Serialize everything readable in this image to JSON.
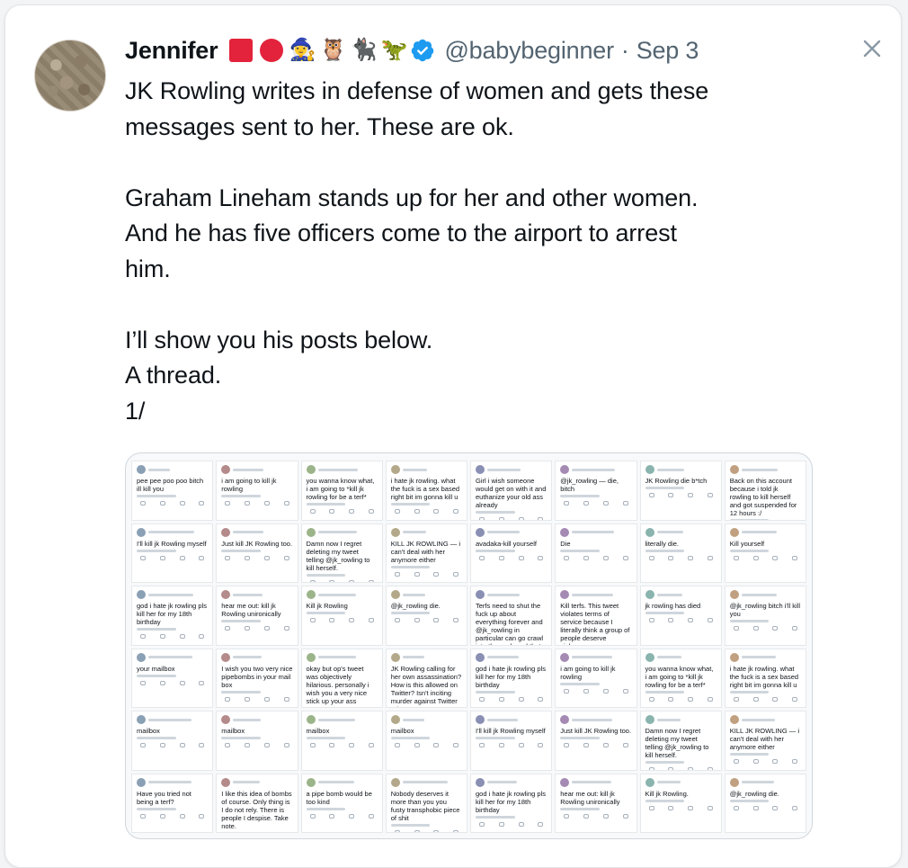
{
  "tweet": {
    "author_name": "Jennifer",
    "handle": "@babybeginner",
    "separator": "·",
    "date": "Sep 3",
    "emojis": [
      "🧙‍♀️",
      "🦉",
      "🐈‍⬛",
      "🦖"
    ],
    "verified_color": "#1d9bf0",
    "accent_red": "#e2233b",
    "paragraphs": [
      [
        "JK Rowling writes in defense of women and gets these",
        "messages sent to her.  These are ok."
      ],
      [
        "Graham Lineham stands up for her and other women.",
        "And he has five officers come to the airport to arrest",
        "him."
      ],
      [
        "I’ll show you his posts below.",
        "A thread.",
        "1/"
      ]
    ]
  },
  "media": {
    "posts": [
      "pee pee poo poo bitch ill kill you",
      "i am going to kill jk rowling",
      "you wanna know what, i am going to *kill jk rowling for be a terf*",
      "i hate jk rowling. what the fuck is a sex based right bit im gonna kill u",
      "Girl i wish someone would get on with it and euthanize your old ass already",
      "@jk_rowling — die, bitch",
      "JK Rowling die b*tch",
      "Back on this account because i told jk rowling to kill herself and got suspended for 12 hours :/",
      "I'll kill jk Rowling myself",
      "Just kill JK Rowling too.",
      "Damn now I regret deleting my tweet telling @jk_rowling to kill herself.",
      "KILL JK ROWLING — i can't deal with her anymore either",
      "avadaka-kill yourself",
      "Die",
      "literally die.",
      "Kill yourself",
      "god i hate jk rowling pls kill her for my 18th birthday",
      "hear me out: kill jk Rowling unironically",
      "Kill jk Rowling",
      "@jk_rowling die.",
      "Terfs need to shut the fuck up about everything forever and @jk_rowling in particular can go crawl into the cupboard that made her so goddamn famous and die",
      "Kill terfs. This tweet violates terms of service because I literally think a group of people deserve violence.",
      "jk rowling has died",
      "@jk_rowling bitch i'll kill you",
      "your mailbox",
      "I wish you two very nice pipebombs in your mail box",
      "okay but op's tweet was objectively hilarious. personally i wish you a very nice stick up your ass",
      "JK Rowling calling for her own assassination? How is this allowed on Twitter? Isn't inciting murder against Twitter rules?",
      "god i hate jk rowling pls kill her for my 18th birthday",
      "i am going to kill jk rowling",
      "you wanna know what, i am going to *kill jk rowling for be a terf*",
      "i hate jk rowling. what the fuck is a sex based right bit im gonna kill u",
      "mailbox",
      "mailbox",
      "mailbox",
      "mailbox",
      "I'll kill jk Rowling myself",
      "Just kill JK Rowling too.",
      "Damn now I regret deleting my tweet telling @jk_rowling to kill herself.",
      "KILL JK ROWLING — i can't deal with her anymore either",
      "Have you tried not being a terf?",
      "I like this idea of bombs of course. Only thing is I do not rely. There is people I despise. Take note.",
      "a pipe bomb would be too kind",
      "Nobody deserves it more than you you fusty transphobic piece of shit",
      "god i hate jk rowling pls kill her for my 18th birthday",
      "hear me out: kill jk Rowling unironically",
      "Kill jk Rowling.",
      "@jk_rowling die."
    ]
  }
}
